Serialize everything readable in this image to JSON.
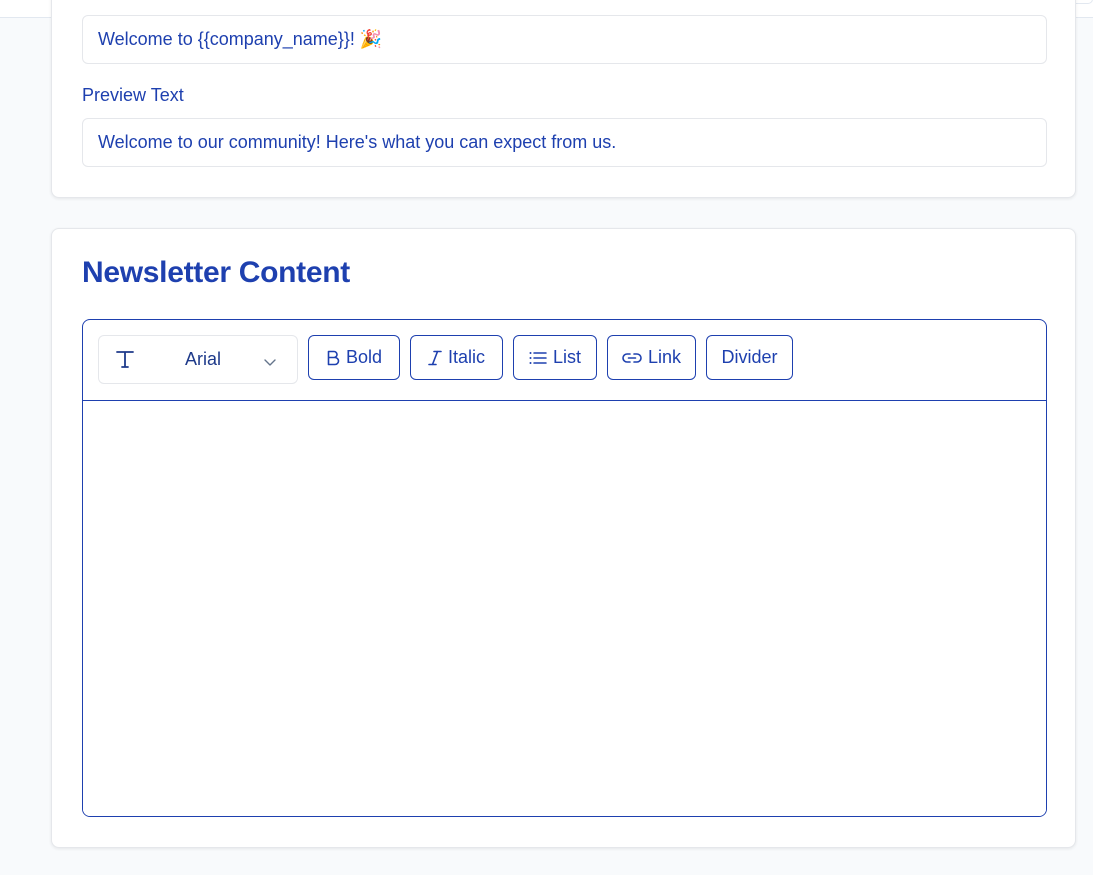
{
  "subject": {
    "value": "Welcome to {{company_name}}! 🎉"
  },
  "preview_text": {
    "label": "Preview Text",
    "value": "Welcome to our community! Here's what you can expect from us."
  },
  "newsletter_content": {
    "title": "Newsletter Content",
    "toolbar": {
      "font": {
        "value": "Arial",
        "icon": "text-type-icon",
        "chevron": "chevron-down-icon"
      },
      "bold_label": "Bold",
      "italic_label": "Italic",
      "list_label": "List",
      "link_label": "Link",
      "divider_label": "Divider"
    },
    "body": ""
  },
  "colors": {
    "primary": "#1e40af",
    "border": "#e5e7eb",
    "page_bg": "#f8fafc"
  }
}
